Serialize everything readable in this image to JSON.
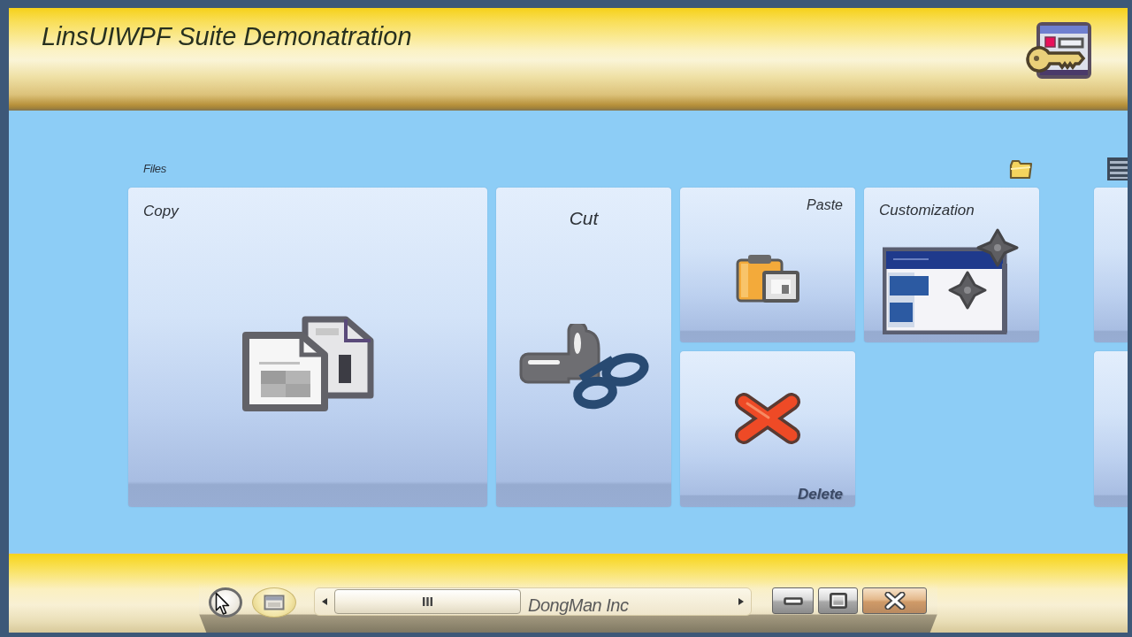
{
  "window": {
    "title": "LinsUIWPF Suite Demonatration"
  },
  "groups": [
    {
      "label": "Files",
      "tiles": [
        {
          "kind": "copy",
          "label": "Copy"
        },
        {
          "kind": "cut",
          "label": "Cut"
        },
        {
          "kind": "paste",
          "label": "Paste"
        },
        {
          "kind": "customization",
          "label": "Customization"
        },
        {
          "kind": "delete",
          "label": "Delete"
        }
      ]
    },
    {
      "tiles": [
        {
          "kind": "blank"
        },
        {
          "kind": "blank"
        }
      ]
    }
  ],
  "status_bar": {
    "text": "DongMan Inc"
  }
}
